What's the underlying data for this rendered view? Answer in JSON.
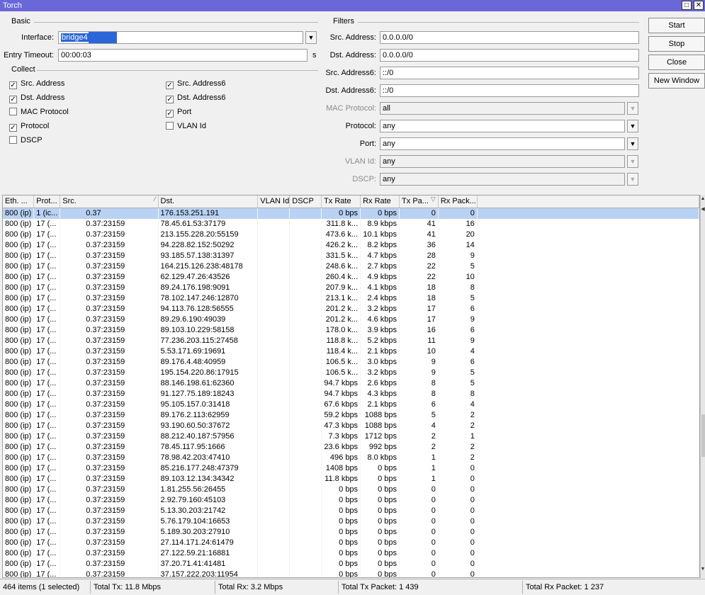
{
  "window": {
    "title": "Torch",
    "restore_glyph": "□",
    "close_glyph": "✕"
  },
  "basic": {
    "section_label": "Basic",
    "interface_label": "Interface:",
    "interface_value": "bridge4",
    "entry_timeout_label": "Entry Timeout:",
    "entry_timeout_value": "00:00:03",
    "entry_timeout_unit": "s"
  },
  "collect": {
    "section_label": "Collect",
    "items": [
      {
        "label": "Src. Address",
        "checked": true
      },
      {
        "label": "Dst. Address",
        "checked": true
      },
      {
        "label": "MAC Protocol",
        "checked": false
      },
      {
        "label": "Protocol",
        "checked": true
      },
      {
        "label": "DSCP",
        "checked": false
      },
      {
        "label": "Src. Address6",
        "checked": true
      },
      {
        "label": "Dst. Address6",
        "checked": true
      },
      {
        "label": "Port",
        "checked": true
      },
      {
        "label": "VLAN Id",
        "checked": false
      }
    ]
  },
  "filters": {
    "section_label": "Filters",
    "src_address_label": "Src. Address:",
    "src_address_value": "0.0.0.0/0",
    "dst_address_label": "Dst. Address:",
    "dst_address_value": "0.0.0.0/0",
    "src_address6_label": "Src. Address6:",
    "src_address6_value": "::/0",
    "dst_address6_label": "Dst. Address6:",
    "dst_address6_value": "::/0",
    "mac_protocol_label": "MAC Protocol:",
    "mac_protocol_value": "all",
    "protocol_label": "Protocol:",
    "protocol_value": "any",
    "port_label": "Port:",
    "port_value": "any",
    "vlan_id_label": "VLAN Id:",
    "vlan_id_value": "any",
    "dscp_label": "DSCP:",
    "dscp_value": "any"
  },
  "buttons": {
    "start": "Start",
    "stop": "Stop",
    "close": "Close",
    "new_window": "New Window"
  },
  "table": {
    "columns": [
      "Eth. ...",
      "Prot...",
      "Src.",
      "Dst.",
      "VLAN Id",
      "DSCP",
      "Tx Rate",
      "Rx Rate",
      "Tx Pa...",
      "Rx Pack..."
    ],
    "rows": [
      [
        "800 (ip)",
        "1 (ic...",
        "0.37",
        "176.153.251.191",
        "",
        "",
        "0 bps",
        "0 bps",
        "0",
        "0"
      ],
      [
        "800 (ip)",
        "17 (...",
        "0.37:23159",
        "78.45.61.53:37179",
        "",
        "",
        "311.8 k...",
        "8.9 kbps",
        "41",
        "16"
      ],
      [
        "800 (ip)",
        "17 (...",
        "0.37:23159",
        "213.155.228.20:55159",
        "",
        "",
        "473.6 k...",
        "10.1 kbps",
        "41",
        "20"
      ],
      [
        "800 (ip)",
        "17 (...",
        "0.37:23159",
        "94.228.82.152:50292",
        "",
        "",
        "426.2 k...",
        "8.2 kbps",
        "36",
        "14"
      ],
      [
        "800 (ip)",
        "17 (...",
        "0.37:23159",
        "93.185.57.138:31397",
        "",
        "",
        "331.5 k...",
        "4.7 kbps",
        "28",
        "9"
      ],
      [
        "800 (ip)",
        "17 (...",
        "0.37:23159",
        "164.215.126.238:48178",
        "",
        "",
        "248.6 k...",
        "2.7 kbps",
        "22",
        "5"
      ],
      [
        "800 (ip)",
        "17 (...",
        "0.37:23159",
        "62.129.47.26:43526",
        "",
        "",
        "260.4 k...",
        "4.9 kbps",
        "22",
        "10"
      ],
      [
        "800 (ip)",
        "17 (...",
        "0.37:23159",
        "89.24.176.198:9091",
        "",
        "",
        "207.9 k...",
        "4.1 kbps",
        "18",
        "8"
      ],
      [
        "800 (ip)",
        "17 (...",
        "0.37:23159",
        "78.102.147.246:12870",
        "",
        "",
        "213.1 k...",
        "2.4 kbps",
        "18",
        "5"
      ],
      [
        "800 (ip)",
        "17 (...",
        "0.37:23159",
        "94.113.76.128:56555",
        "",
        "",
        "201.2 k...",
        "3.2 kbps",
        "17",
        "6"
      ],
      [
        "800 (ip)",
        "17 (...",
        "0.37:23159",
        "89.29.6.190:49039",
        "",
        "",
        "201.2 k...",
        "4.6 kbps",
        "17",
        "9"
      ],
      [
        "800 (ip)",
        "17 (...",
        "0.37:23159",
        "89.103.10.229:58158",
        "",
        "",
        "178.0 k...",
        "3.9 kbps",
        "16",
        "6"
      ],
      [
        "800 (ip)",
        "17 (...",
        "0.37:23159",
        "77.236.203.115:27458",
        "",
        "",
        "118.8 k...",
        "5.2 kbps",
        "11",
        "9"
      ],
      [
        "800 (ip)",
        "17 (...",
        "0.37:23159",
        "5.53.171.69:19691",
        "",
        "",
        "118.4 k...",
        "2.1 kbps",
        "10",
        "4"
      ],
      [
        "800 (ip)",
        "17 (...",
        "0.37:23159",
        "89.176.4.48:40959",
        "",
        "",
        "106.5 k...",
        "3.0 kbps",
        "9",
        "6"
      ],
      [
        "800 (ip)",
        "17 (...",
        "0.37:23159",
        "195.154.220.86:17915",
        "",
        "",
        "106.5 k...",
        "3.2 kbps",
        "9",
        "5"
      ],
      [
        "800 (ip)",
        "17 (...",
        "0.37:23159",
        "88.146.198.61:62360",
        "",
        "",
        "94.7 kbps",
        "2.6 kbps",
        "8",
        "5"
      ],
      [
        "800 (ip)",
        "17 (...",
        "0.37:23159",
        "91.127.75.189:18243",
        "",
        "",
        "94.7 kbps",
        "4.3 kbps",
        "8",
        "8"
      ],
      [
        "800 (ip)",
        "17 (...",
        "0.37:23159",
        "95.105.157.0:31418",
        "",
        "",
        "67.6 kbps",
        "2.1 kbps",
        "6",
        "4"
      ],
      [
        "800 (ip)",
        "17 (...",
        "0.37:23159",
        "89.176.2.113:62959",
        "",
        "",
        "59.2 kbps",
        "1088 bps",
        "5",
        "2"
      ],
      [
        "800 (ip)",
        "17 (...",
        "0.37:23159",
        "93.190.60.50:37672",
        "",
        "",
        "47.3 kbps",
        "1088 bps",
        "4",
        "2"
      ],
      [
        "800 (ip)",
        "17 (...",
        "0.37:23159",
        "88.212.40.187:57956",
        "",
        "",
        "7.3 kbps",
        "1712 bps",
        "2",
        "1"
      ],
      [
        "800 (ip)",
        "17 (...",
        "0.37:23159",
        "78.45.117.95:1666",
        "",
        "",
        "23.6 kbps",
        "992 bps",
        "2",
        "2"
      ],
      [
        "800 (ip)",
        "17 (...",
        "0.37:23159",
        "78.98.42.203:47410",
        "",
        "",
        "496 bps",
        "8.0 kbps",
        "1",
        "2"
      ],
      [
        "800 (ip)",
        "17 (...",
        "0.37:23159",
        "85.216.177.248:47379",
        "",
        "",
        "1408 bps",
        "0 bps",
        "1",
        "0"
      ],
      [
        "800 (ip)",
        "17 (...",
        "0.37:23159",
        "89.103.12.134:34342",
        "",
        "",
        "11.8 kbps",
        "0 bps",
        "1",
        "0"
      ],
      [
        "800 (ip)",
        "17 (...",
        "0.37:23159",
        "1.81.255.56:26455",
        "",
        "",
        "0 bps",
        "0 bps",
        "0",
        "0"
      ],
      [
        "800 (ip)",
        "17 (...",
        "0.37:23159",
        "2.92.79.160:45103",
        "",
        "",
        "0 bps",
        "0 bps",
        "0",
        "0"
      ],
      [
        "800 (ip)",
        "17 (...",
        "0.37:23159",
        "5.13.30.203:21742",
        "",
        "",
        "0 bps",
        "0 bps",
        "0",
        "0"
      ],
      [
        "800 (ip)",
        "17 (...",
        "0.37:23159",
        "5.76.179.104:16653",
        "",
        "",
        "0 bps",
        "0 bps",
        "0",
        "0"
      ],
      [
        "800 (ip)",
        "17 (...",
        "0.37:23159",
        "5.189.30.203:27910",
        "",
        "",
        "0 bps",
        "0 bps",
        "0",
        "0"
      ],
      [
        "800 (ip)",
        "17 (...",
        "0.37:23159",
        "27.114.171.24:61479",
        "",
        "",
        "0 bps",
        "0 bps",
        "0",
        "0"
      ],
      [
        "800 (ip)",
        "17 (...",
        "0.37:23159",
        "27.122.59.21:16881",
        "",
        "",
        "0 bps",
        "0 bps",
        "0",
        "0"
      ],
      [
        "800 (ip)",
        "17 (...",
        "0.37:23159",
        "37.20.71.41:41481",
        "",
        "",
        "0 bps",
        "0 bps",
        "0",
        "0"
      ],
      [
        "800 (ip)",
        "17 (...",
        "0.37:23159",
        "37.157.222.203:11954",
        "",
        "",
        "0 bps",
        "0 bps",
        "0",
        "0"
      ]
    ]
  },
  "status": {
    "items": "464 items (1 selected)",
    "total_tx": "Total Tx: 11.8 Mbps",
    "total_rx": "Total Rx: 3.2 Mbps",
    "total_tx_packet": "Total Tx Packet: 1 439",
    "total_rx_packet": "Total Rx Packet: 1 237"
  },
  "colors": {
    "titlebar": "#6a67d9",
    "selection": "#2a66d9",
    "selected_row": "#b9d1f3"
  }
}
